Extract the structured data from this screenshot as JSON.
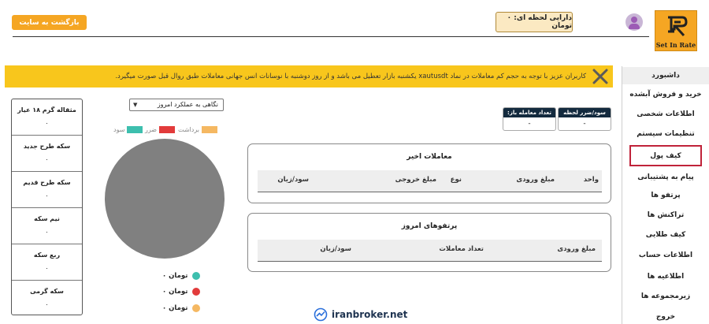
{
  "header": {
    "brand": "Set In Rate",
    "balance_label": "دارایی لحظه ای: ۰ تومان",
    "back_button": "بازگشت به سایت"
  },
  "sidebar": {
    "items": [
      {
        "label": "داشبورد",
        "active": true
      },
      {
        "label": "خرید و فروش آبشده"
      },
      {
        "label": "اطلاعات شخصی"
      },
      {
        "label": "تنظیمات سیستم"
      },
      {
        "label": "کیف پول",
        "highlighted": true
      },
      {
        "label": "پیام به پشتیبانی"
      },
      {
        "label": "پرتفو ها"
      },
      {
        "label": "تراکنش ها"
      },
      {
        "label": "کیف طلایی"
      },
      {
        "label": "اطلاعات حساب"
      },
      {
        "label": "اطلاعیه ها"
      },
      {
        "label": "زیرمجموعه ها"
      },
      {
        "label": "خروج"
      }
    ]
  },
  "alert": {
    "text": "کاربران عزیز با توجه به حجم کم معاملات در نماد xautusdt یکشنبه بازار تعطیل می باشد و از روز دوشنبه با نوسانات انس جهانی معاملات طبق روال قبل صورت میگیرد.",
    "color": "#f8c61c"
  },
  "stats": {
    "profit_loss": {
      "label": "سود/ضرر لحظه ای:",
      "value": "-"
    },
    "open_trades": {
      "label": "تعداد معامله باز:",
      "value": "-"
    }
  },
  "recent_trades": {
    "title": "معاملات اخیر",
    "columns": [
      "واحد",
      "مبلغ ورودی",
      "نوع",
      "مبلغ خروجی",
      "سود/زیان"
    ]
  },
  "today_portfolio": {
    "title": "پرتفوهای امروز",
    "columns": [
      "مبلغ ورودی",
      "تعداد معاملات",
      "سود/زیان"
    ]
  },
  "chart": {
    "select_value": "نگاهی به عملکرد امروز",
    "legend": [
      {
        "name": "برداشت",
        "color": "#f5b862"
      },
      {
        "name": "ضرر",
        "color": "#e23b3b"
      },
      {
        "name": "سود",
        "color": "#3dbfae"
      }
    ],
    "values": [
      {
        "amount": "۰ تومان",
        "color": "#3dbfae"
      },
      {
        "amount": "۰ تومان",
        "color": "#e23b3b"
      },
      {
        "amount": "۰ تومان",
        "color": "#f5b862"
      }
    ],
    "pie_color": "#808080"
  },
  "coins": [
    {
      "name": "مثقاله گرم ۱۸ عیار",
      "value": "۰"
    },
    {
      "name": "سکه طرح جدید",
      "value": "۰"
    },
    {
      "name": "سکه طرح قدیم",
      "value": "۰"
    },
    {
      "name": "نیم سکه",
      "value": "۰"
    },
    {
      "name": "ربع سکه",
      "value": "۰"
    },
    {
      "name": "سکه گرمی",
      "value": "۰"
    }
  ],
  "watermark": "iranbroker.net"
}
